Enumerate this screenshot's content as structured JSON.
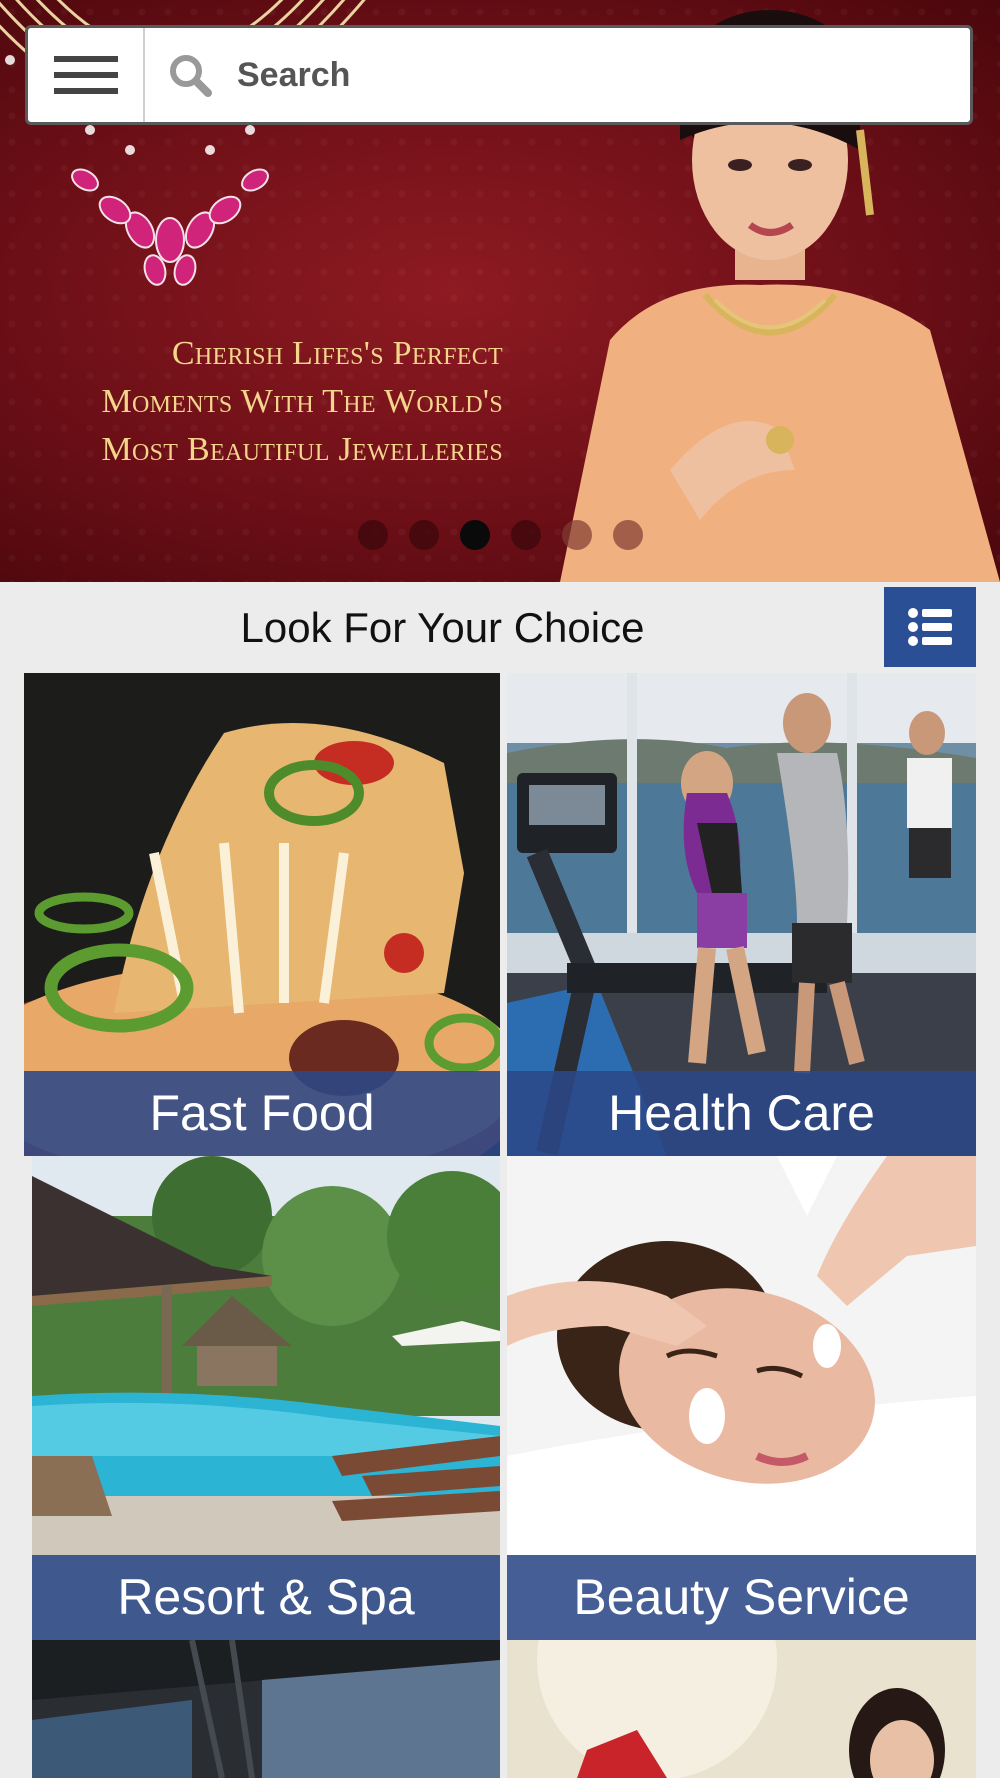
{
  "search": {
    "placeholder": "Search"
  },
  "banner": {
    "lines": [
      "Cherish Lifes's Perfect",
      "Moments With The World's",
      "Most Beautiful Jewelleries"
    ],
    "slide_count": 6,
    "active_slide": 3
  },
  "section": {
    "title": "Look For Your Choice"
  },
  "categories": [
    {
      "label": "Fast Food"
    },
    {
      "label": "Health Care"
    },
    {
      "label": "Resort & Spa"
    },
    {
      "label": "Beauty Service"
    }
  ],
  "colors": {
    "accent_blue": "#2a4f95",
    "banner_red": "#7a1219",
    "banner_gold": "#f3d58c",
    "background": "#ececec"
  },
  "icons": {
    "menu": "hamburger-icon",
    "search": "search-icon",
    "list_view": "list-view-icon"
  }
}
